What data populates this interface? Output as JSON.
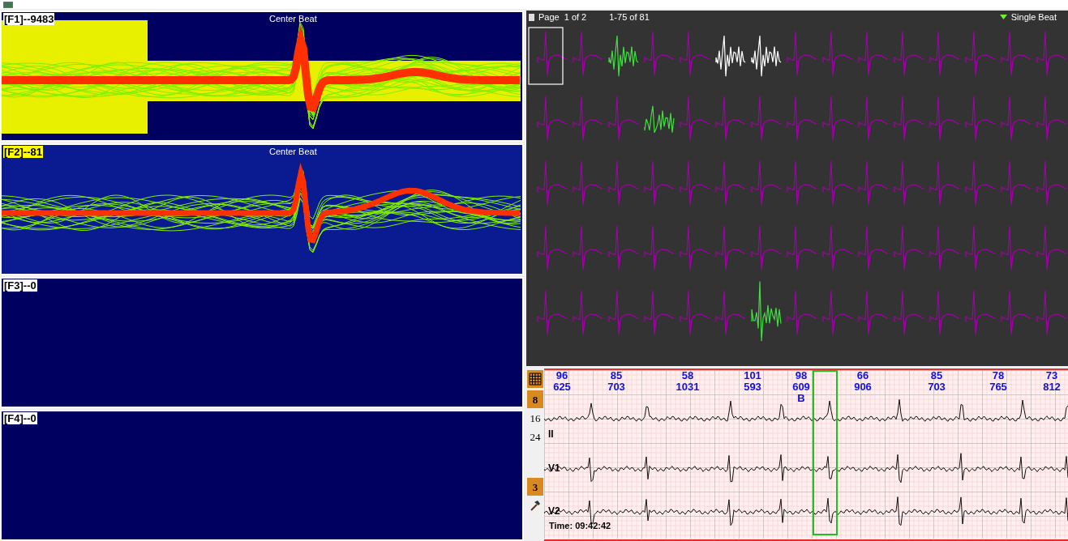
{
  "template_panes": [
    {
      "label": "[F1]--9483",
      "title": "Center Beat",
      "selected": false,
      "kind": "dense"
    },
    {
      "label": "[F2]--81",
      "title": "Center Beat",
      "selected": true,
      "kind": "sparse"
    },
    {
      "label": "[F3]--0",
      "selected": false,
      "kind": "empty"
    },
    {
      "label": "[F4]--0",
      "selected": false,
      "kind": "empty"
    }
  ],
  "gallery": {
    "page_label": "Page",
    "page": "1 of 2",
    "range": "1-75 of 81",
    "mode": "Single Beat"
  },
  "strip_tools": [
    {
      "kind": "grid",
      "selected": true
    },
    {
      "kind": "text",
      "text": "8",
      "selected": true
    },
    {
      "kind": "text",
      "text": "16",
      "selected": false
    },
    {
      "kind": "text",
      "text": "24",
      "selected": false
    },
    {
      "kind": "text",
      "text": "3",
      "selected": true
    },
    {
      "kind": "hammer",
      "selected": false
    }
  ],
  "beat_labels": [
    {
      "rate": "96",
      "interval": "625"
    },
    {
      "rate": "85",
      "interval": "703"
    },
    {
      "rate": "58",
      "interval": "1031"
    },
    {
      "rate": "101",
      "interval": "593"
    },
    {
      "rate": "98",
      "interval": "609",
      "mark": "B"
    },
    {
      "rate": "66",
      "interval": "906"
    },
    {
      "rate": "85",
      "interval": "703"
    },
    {
      "rate": "78",
      "interval": "765"
    },
    {
      "rate": "73",
      "interval": "812"
    }
  ],
  "leads": [
    "II",
    "V1",
    "V2"
  ],
  "time": "Time: 09:42:42"
}
